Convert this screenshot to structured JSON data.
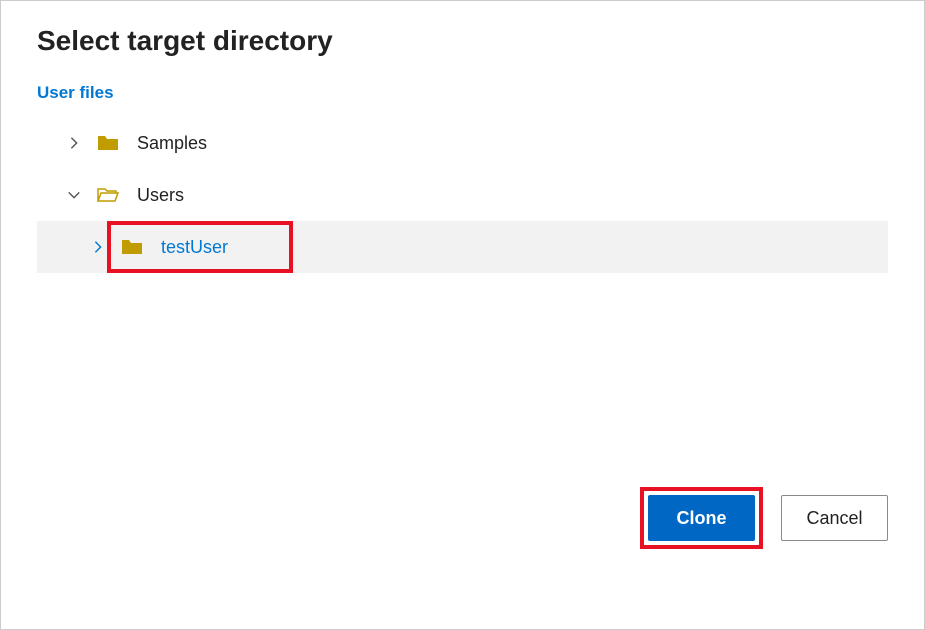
{
  "dialog": {
    "title": "Select target directory"
  },
  "section": {
    "label": "User files"
  },
  "tree": {
    "items": [
      {
        "label": "Samples",
        "expanded": false,
        "folderOpen": false,
        "indent": 0,
        "selected": false
      },
      {
        "label": "Users",
        "expanded": true,
        "folderOpen": true,
        "indent": 0,
        "selected": false
      },
      {
        "label": "testUser",
        "expanded": false,
        "folderOpen": false,
        "indent": 1,
        "selected": true
      }
    ]
  },
  "footer": {
    "primary": "Clone",
    "secondary": "Cancel"
  },
  "colors": {
    "accent": "#0078d4",
    "highlight": "#e81123",
    "folder": "#c19c00"
  }
}
